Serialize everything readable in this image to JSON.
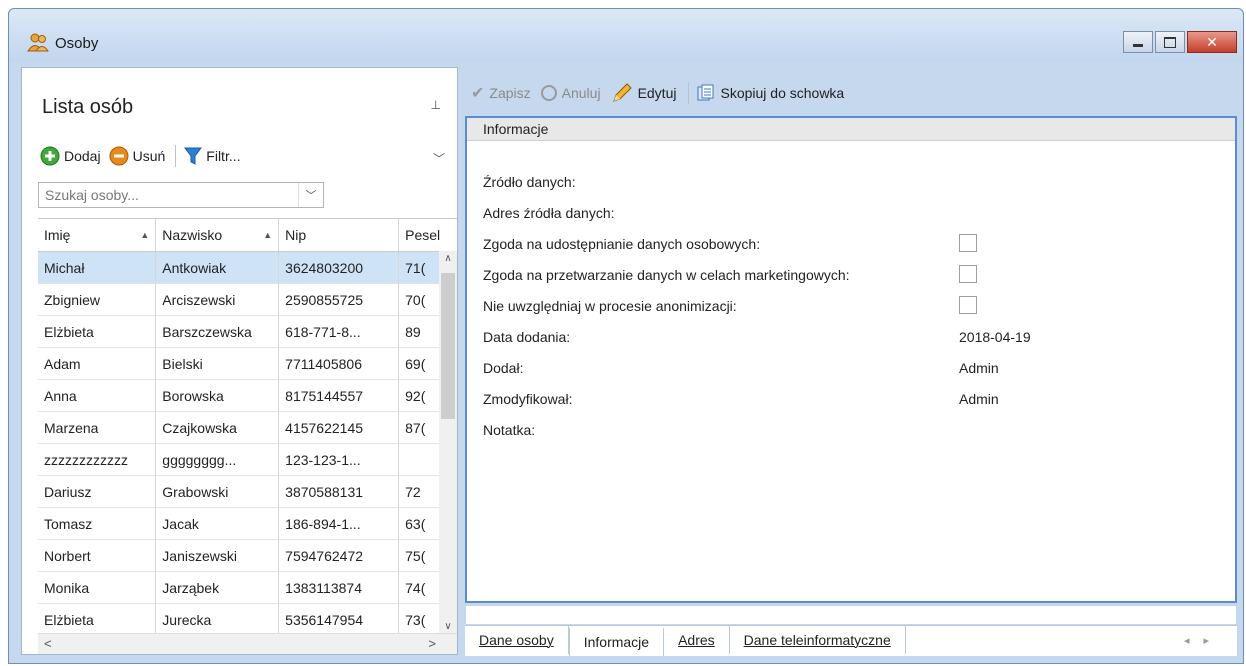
{
  "window": {
    "title": "Osoby",
    "minimize_icon": "minimize-icon",
    "maximize_icon": "maximize-icon",
    "close_icon": "close-icon"
  },
  "left_panel": {
    "title": "Lista osób",
    "toolbar": {
      "add_label": "Dodaj",
      "remove_label": "Usuń",
      "filter_label": "Filtr..."
    },
    "search": {
      "placeholder": "Szukaj osoby..."
    },
    "table": {
      "columns": [
        "Imię",
        "Nazwisko",
        "Nip",
        "Pesel"
      ],
      "rows": [
        [
          "Michał",
          "Antkowiak",
          "3624803200",
          "71("
        ],
        [
          "Zbigniew",
          "Arciszewski",
          "2590855725",
          "70("
        ],
        [
          "Elżbieta",
          "Barszczewska",
          "618-771-8...",
          "89"
        ],
        [
          "Adam",
          "Bielski",
          "7711405806",
          "69("
        ],
        [
          "Anna",
          "Borowska",
          "8175144557",
          "92("
        ],
        [
          "Marzena",
          "Czajkowska",
          "4157622145",
          "87("
        ],
        [
          "zzzzzzzzzzzz",
          "gggggggg...",
          "123-123-1...",
          ""
        ],
        [
          "Dariusz",
          "Grabowski",
          "3870588131",
          "72"
        ],
        [
          "Tomasz",
          "Jacak",
          "186-894-1...",
          "63("
        ],
        [
          "Norbert",
          "Janiszewski",
          "7594762472",
          "75("
        ],
        [
          "Monika",
          "Jarząbek",
          "1383113874",
          "74("
        ],
        [
          "Elżbieta",
          "Jurecka",
          "5356147954",
          "73("
        ]
      ],
      "selected_row": 0
    }
  },
  "right_toolbar": {
    "save_label": "Zapisz",
    "cancel_label": "Anuluj",
    "edit_label": "Edytuj",
    "copy_label": "Skopiuj do schowka"
  },
  "info_section": {
    "header": "Informacje",
    "fields": {
      "source": "Źródło danych:",
      "source_address": "Adres źródła danych:",
      "consent_share": "Zgoda na udostępnianie danych osobowych:",
      "consent_marketing": "Zgoda na przetwarzanie danych w celach marketingowych:",
      "exclude_anon": "Nie uwzględniaj w procesie anonimizacji:",
      "date_added_label": "Data dodania:",
      "date_added_value": "2018-04-19",
      "added_by_label": "Dodał:",
      "added_by_value": "Admin",
      "modified_by_label": "Zmodyfikował:",
      "modified_by_value": "Admin",
      "note_label": "Notatka:"
    }
  },
  "tabs": [
    "Dane osoby",
    "Informacje",
    "Adres",
    "Dane teleinformatyczne"
  ],
  "active_tab": "Informacje"
}
